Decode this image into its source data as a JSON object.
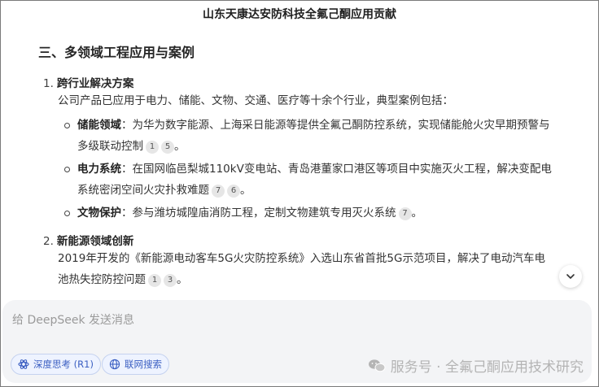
{
  "title": "山东天康达安防科技全氟己酮应用贡献",
  "section_heading": "三、多领域工程应用与案例",
  "items": [
    {
      "number": "1.",
      "heading": "跨行业解决方案",
      "intro": "公司产品已应用于电力、储能、文物、交通、医疗等十余个行业，典型案例包括：",
      "bullets": [
        {
          "label": "储能领域",
          "sep": "：",
          "line1": "为华为数字能源、上海采日能源等提供全氟己酮防控系统，实现储能舱火灾早期预警与",
          "line2": "多级联动控制",
          "cites": [
            "1",
            "5"
          ]
        },
        {
          "label": "电力系统",
          "sep": "：",
          "line1": "在国网临邑梨城110kV变电站、青岛港董家口港区等项目中实施灭火工程，解决变配电",
          "line2": "系统密闭空间火灾扑救难题",
          "cites": [
            "7",
            "6"
          ]
        },
        {
          "label": "文物保护",
          "sep": "：",
          "line1": "参与潍坊城隍庙消防工程，定制文物建筑专用灭火系统",
          "line2": "",
          "cites": [
            "7"
          ]
        }
      ]
    },
    {
      "number": "2.",
      "heading": "新能源领域创新",
      "para_line1": "2019年开发的《新能源电动客车5G火灾防控系统》入选山东省首批5G示范项目，解决了电动汽车电",
      "para_line2": "池热失控防控问题",
      "cites": [
        "1",
        "3"
      ]
    }
  ],
  "composer": {
    "placeholder": "给 DeepSeek 发送消息",
    "deep_think": "深度思考 (R1)",
    "web_search": "联网搜索"
  },
  "watermark": "服务号 · 全氟己酮应用技术研究",
  "icons": [
    "chevron-down-icon",
    "deep-think-icon",
    "globe-icon",
    "wechat-icon"
  ]
}
